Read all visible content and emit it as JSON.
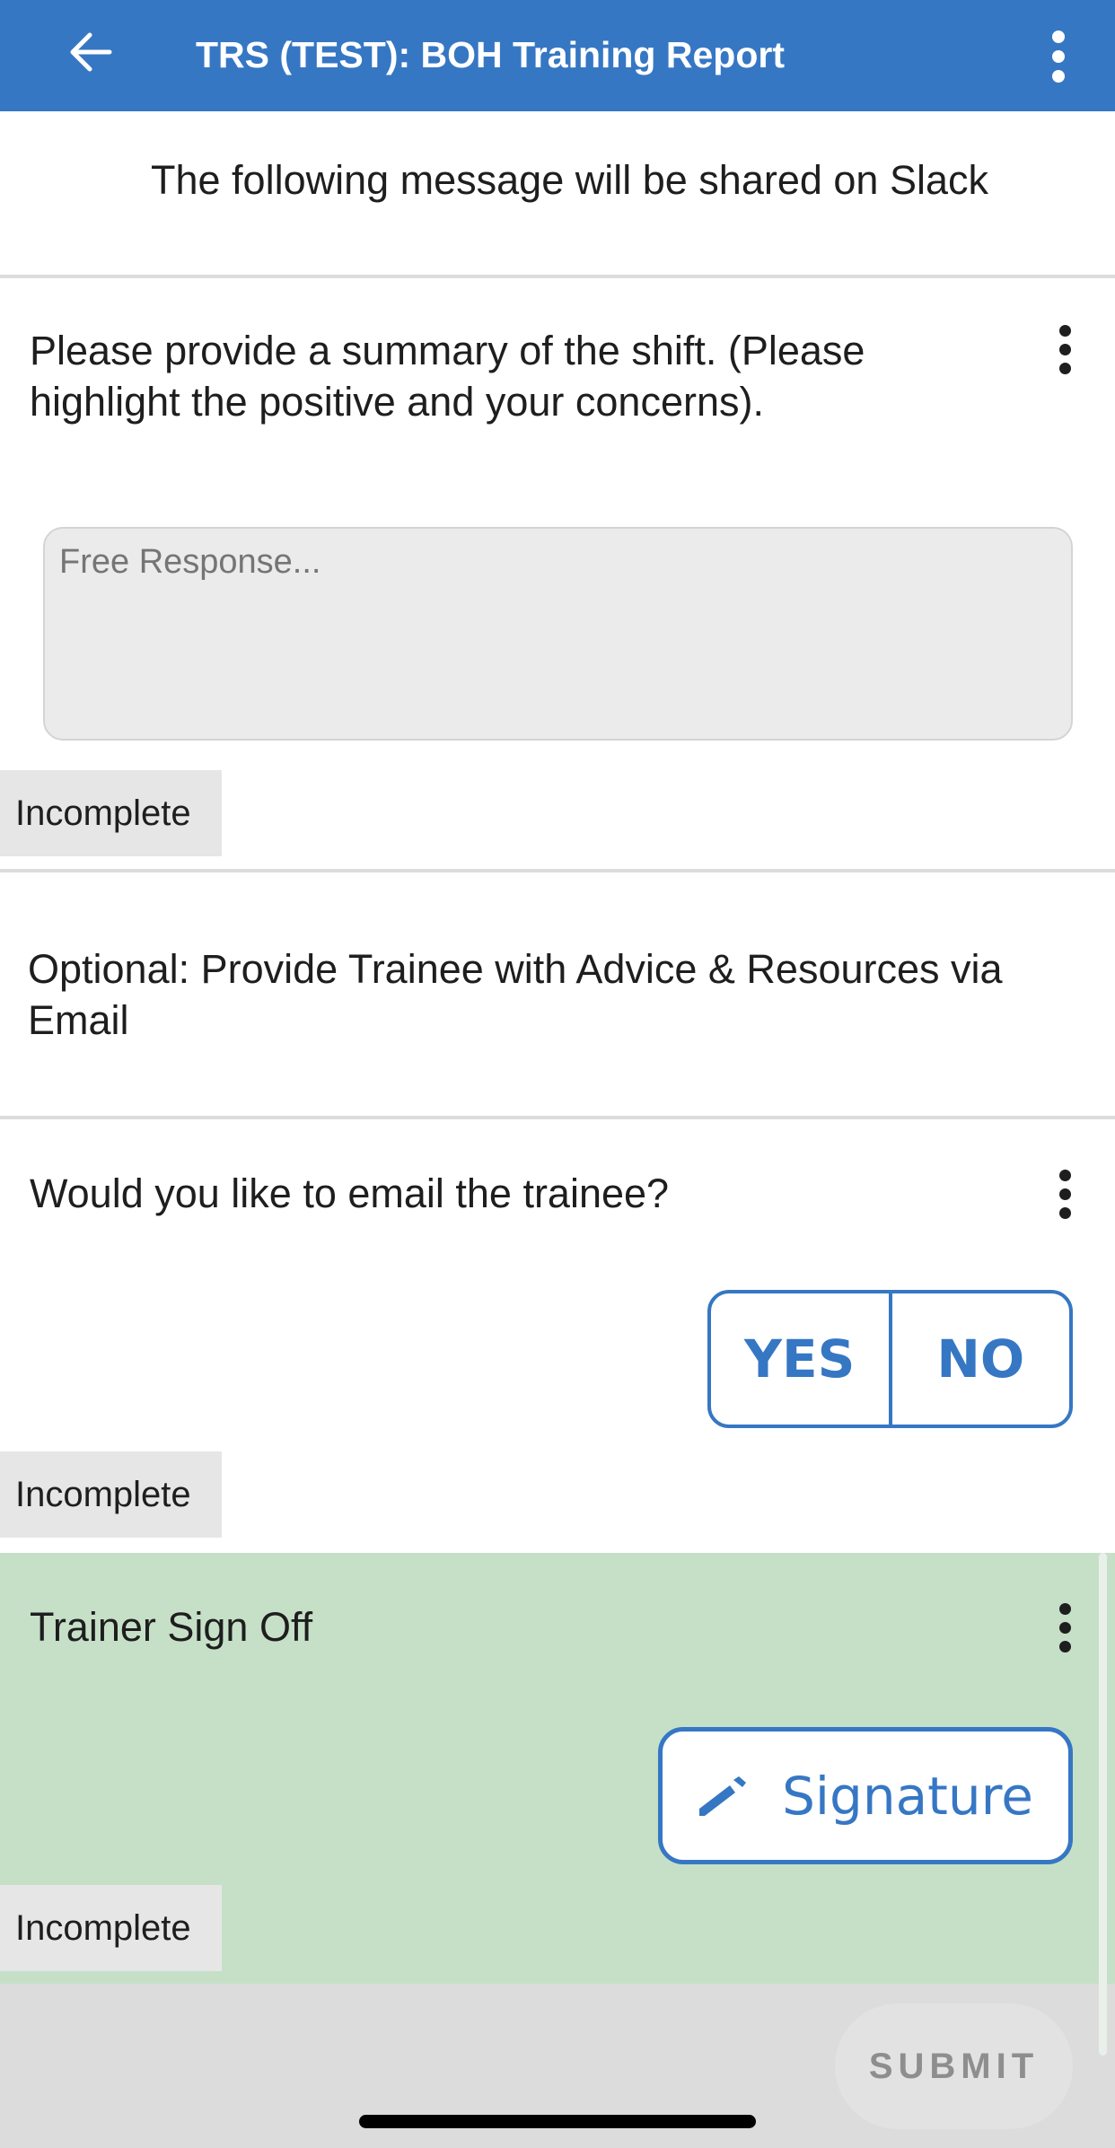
{
  "header": {
    "title": "TRS (TEST): BOH Training Report",
    "back_icon": "arrow-left-icon",
    "menu_icon": "more-vertical-icon"
  },
  "intro": {
    "text": "The following message will be shared on Slack"
  },
  "summary": {
    "question": "Please provide a summary of the shift. (Please highlight the positive and your concerns).",
    "placeholder": "Free Response...",
    "value": "",
    "status": "Incomplete"
  },
  "optional": {
    "text": "Optional: Provide Trainee with Advice & Resources via Email"
  },
  "email": {
    "question": "Would you like to email the trainee?",
    "yes_label": "YES",
    "no_label": "NO",
    "status": "Incomplete"
  },
  "signoff": {
    "title": "Trainer Sign Off",
    "signature_label": "Signature",
    "signature_icon": "pencil-icon",
    "status": "Incomplete",
    "background": "#c6e0c8"
  },
  "footer": {
    "submit_label": "SUBMIT"
  },
  "colors": {
    "accent": "#3677c4",
    "header_bg": "#3677c4"
  }
}
